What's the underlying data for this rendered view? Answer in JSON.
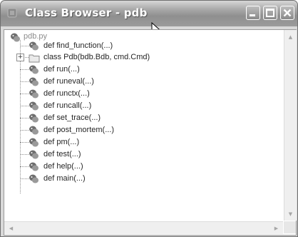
{
  "window": {
    "title": "Class Browser - pdb",
    "accent": "#9a9a9a",
    "title_color": "#ffffff"
  },
  "titlebar_buttons": [
    {
      "name": "minimize",
      "icon": "minimize-icon"
    },
    {
      "name": "maximize",
      "icon": "maximize-icon"
    },
    {
      "name": "close",
      "icon": "close-icon"
    }
  ],
  "tree": {
    "root": {
      "label": "pdb.py",
      "icon": "python-module-icon"
    },
    "items": [
      {
        "label": "def find_function(...)",
        "icon": "python-function-icon",
        "expander": ""
      },
      {
        "label": "class Pdb(bdb.Bdb, cmd.Cmd)",
        "icon": "folder-class-icon",
        "expander": "+"
      },
      {
        "label": "def run(...)",
        "icon": "python-function-icon",
        "expander": ""
      },
      {
        "label": "def runeval(...)",
        "icon": "python-function-icon",
        "expander": ""
      },
      {
        "label": "def runctx(...)",
        "icon": "python-function-icon",
        "expander": ""
      },
      {
        "label": "def runcall(...)",
        "icon": "python-function-icon",
        "expander": ""
      },
      {
        "label": "def set_trace(...)",
        "icon": "python-function-icon",
        "expander": ""
      },
      {
        "label": "def post_mortem(...)",
        "icon": "python-function-icon",
        "expander": ""
      },
      {
        "label": "def pm(...)",
        "icon": "python-function-icon",
        "expander": ""
      },
      {
        "label": "def test(...)",
        "icon": "python-function-icon",
        "expander": ""
      },
      {
        "label": "def help(...)",
        "icon": "python-function-icon",
        "expander": ""
      },
      {
        "label": "def main(...)",
        "icon": "python-function-icon",
        "expander": ""
      }
    ]
  },
  "scrollbars": {
    "vertical": "scrollbar-vertical",
    "horizontal": "scrollbar-horizontal"
  }
}
